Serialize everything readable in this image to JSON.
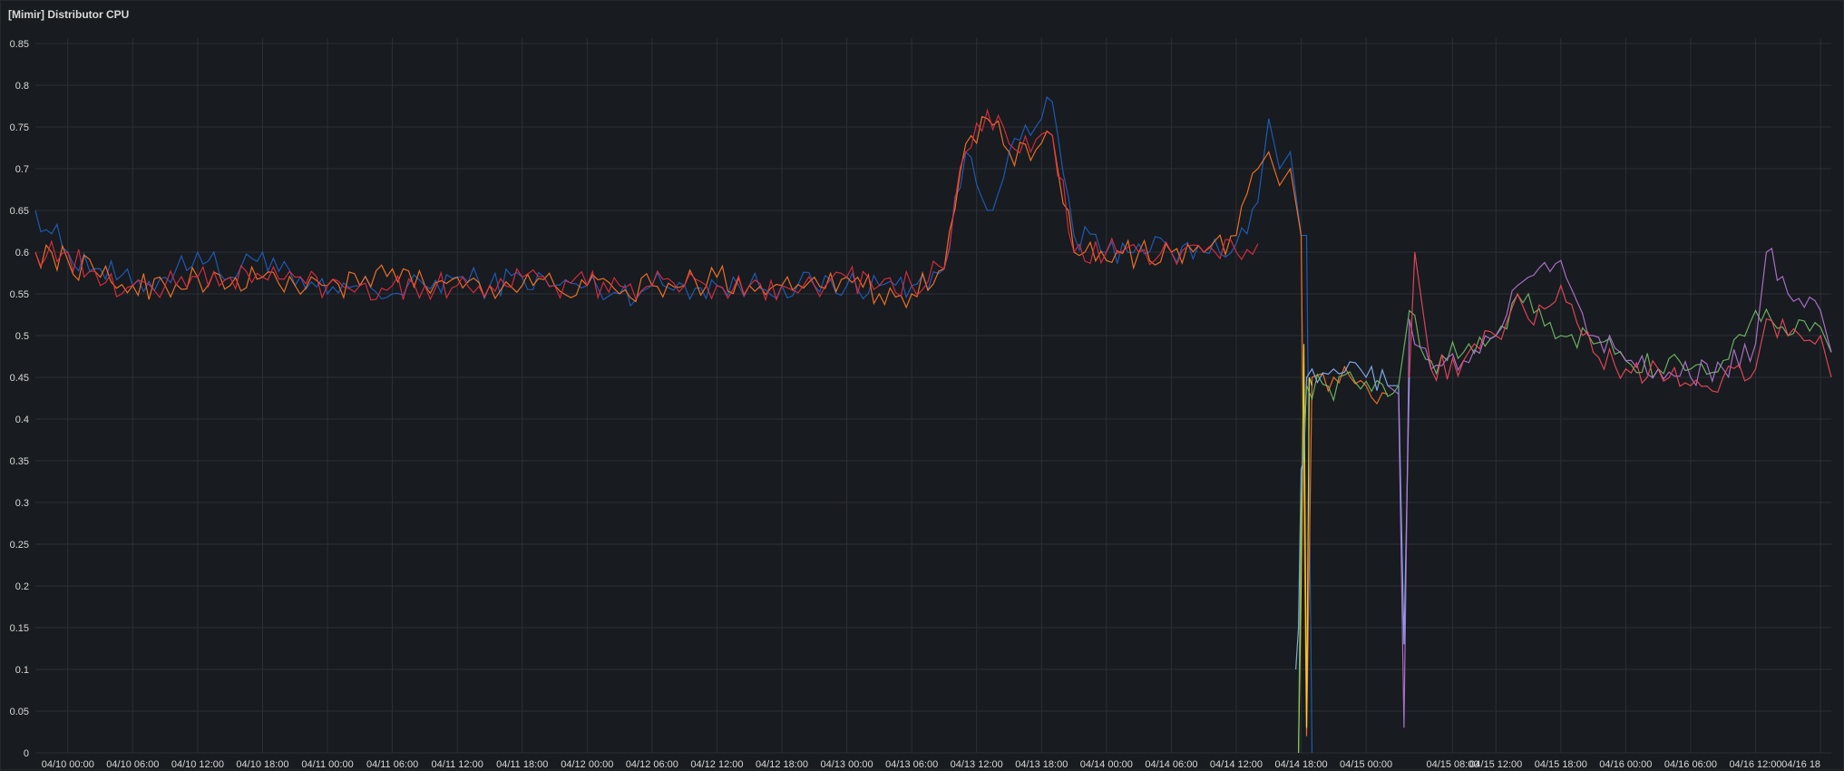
{
  "panel": {
    "title": "[Mimir] Distributor CPU"
  },
  "chart_data": {
    "type": "line",
    "title": "[Mimir] Distributor CPU",
    "xlabel": "",
    "ylabel": "",
    "ylim": [
      0,
      0.85
    ],
    "xlim": [
      "04/09 21:00",
      "04/16 19:00"
    ],
    "grid": true,
    "legend": "none",
    "yticks": [
      0,
      0.05,
      0.1,
      0.15,
      0.2,
      0.25,
      0.3,
      0.35,
      0.4,
      0.45,
      0.5,
      0.55,
      0.6,
      0.65,
      0.7,
      0.75,
      0.8,
      0.85
    ],
    "ytick_labels": [
      "0",
      "0.05",
      "0.1",
      "0.15",
      "0.2",
      "0.25",
      "0.3",
      "0.35",
      "0.4",
      "0.45",
      "0.5",
      "0.55",
      "0.6",
      "0.65",
      "0.7",
      "0.75",
      "0.8",
      "0.85"
    ],
    "xticks": [
      "04/10 00:00",
      "04/10 06:00",
      "04/10 12:00",
      "04/10 18:00",
      "04/11 00:00",
      "04/11 06:00",
      "04/11 12:00",
      "04/11 18:00",
      "04/12 00:00",
      "04/12 06:00",
      "04/12 12:00",
      "04/12 18:00",
      "04/13 00:00",
      "04/13 06:00",
      "04/13 12:00",
      "04/13 18:00",
      "04/14 00:00",
      "04/14 06:00",
      "04/14 12:00",
      "04/14 18:00",
      "04/15 00:00",
      "04/15 08:00",
      "04/15 12:00",
      "04/15 18:00",
      "04/16 00:00",
      "04/16 06:00",
      "04/16 12:00",
      "04/16 18"
    ],
    "series": [
      {
        "color": "#1f60c4",
        "x": [
          "04/09 21:00",
          "04/10 00:00",
          "04/10 03:00",
          "04/10 06:00",
          "04/10 09:00",
          "04/10 12:00",
          "04/10 15:00",
          "04/10 18:00",
          "04/10 21:00",
          "04/11 00:00",
          "04/11 03:00",
          "04/11 06:00",
          "04/11 09:00",
          "04/11 12:00",
          "04/11 15:00",
          "04/11 18:00",
          "04/11 21:00",
          "04/12 00:00",
          "04/12 03:00",
          "04/12 06:00",
          "04/12 09:00",
          "04/12 12:00",
          "04/12 15:00",
          "04/12 18:00",
          "04/12 21:00",
          "04/13 00:00",
          "04/13 03:00",
          "04/13 06:00",
          "04/13 09:00",
          "04/13 11:00",
          "04/13 13:00",
          "04/13 15:00",
          "04/13 17:00",
          "04/13 19:00",
          "04/13 21:00",
          "04/14 00:00",
          "04/14 03:00",
          "04/14 06:00",
          "04/14 09:00",
          "04/14 12:00",
          "04/14 14:00",
          "04/14 15:00",
          "04/14 16:00",
          "04/14 17:00",
          "04/14 18:00",
          "04/14 18:30",
          "04/14 19:00",
          "04/14 21:00",
          "04/15 00:00",
          "04/15 02:00",
          "04/15 03:00"
        ],
        "values": [
          0.65,
          0.6,
          0.58,
          0.56,
          0.57,
          0.6,
          0.57,
          0.6,
          0.56,
          0.55,
          0.56,
          0.55,
          0.56,
          0.57,
          0.56,
          0.57,
          0.56,
          0.56,
          0.55,
          0.56,
          0.56,
          0.56,
          0.56,
          0.56,
          0.56,
          0.56,
          0.56,
          0.56,
          0.58,
          0.72,
          0.65,
          0.72,
          0.74,
          0.78,
          0.62,
          0.6,
          0.61,
          0.6,
          0.6,
          0.61,
          0.66,
          0.76,
          0.7,
          0.72,
          0.62,
          0.62,
          0.0,
          null,
          null,
          null,
          null
        ]
      },
      {
        "color": "#ff7828",
        "x": [
          "04/09 21:00",
          "04/10 00:00",
          "04/10 03:00",
          "04/10 06:00",
          "04/10 09:00",
          "04/10 12:00",
          "04/10 15:00",
          "04/10 18:00",
          "04/10 21:00",
          "04/11 00:00",
          "04/11 03:00",
          "04/11 06:00",
          "04/11 09:00",
          "04/11 12:00",
          "04/11 15:00",
          "04/11 18:00",
          "04/11 21:00",
          "04/12 00:00",
          "04/12 03:00",
          "04/12 06:00",
          "04/12 09:00",
          "04/12 12:00",
          "04/12 15:00",
          "04/12 18:00",
          "04/12 21:00",
          "04/13 00:00",
          "04/13 03:00",
          "04/13 06:00",
          "04/13 09:00",
          "04/13 11:00",
          "04/13 13:00",
          "04/13 15:00",
          "04/13 17:00",
          "04/13 19:00",
          "04/13 21:00",
          "04/14 00:00",
          "04/14 03:00",
          "04/14 06:00",
          "04/14 09:00",
          "04/14 12:00",
          "04/14 14:00",
          "04/14 15:00",
          "04/14 16:00",
          "04/14 17:00",
          "04/14 18:00",
          "04/14 18:30",
          "04/14 19:00",
          "04/14 21:00",
          "04/15 00:00",
          "04/15 02:00",
          "04/15 03:00"
        ],
        "values": [
          0.6,
          0.59,
          0.57,
          0.56,
          0.56,
          0.57,
          0.56,
          0.57,
          0.56,
          0.56,
          0.56,
          0.58,
          0.56,
          0.57,
          0.56,
          0.56,
          0.56,
          0.56,
          0.55,
          0.56,
          0.56,
          0.57,
          0.56,
          0.56,
          0.57,
          0.57,
          0.55,
          0.55,
          0.58,
          0.73,
          0.76,
          0.72,
          0.71,
          0.74,
          0.6,
          0.59,
          0.6,
          0.6,
          0.6,
          0.62,
          0.7,
          0.72,
          0.68,
          0.7,
          0.62,
          0.02,
          0.45,
          0.45,
          0.44,
          0.43,
          null
        ]
      },
      {
        "color": "#e02f44",
        "x": [
          "04/09 21:00",
          "04/10 00:00",
          "04/10 03:00",
          "04/10 06:00",
          "04/10 09:00",
          "04/10 12:00",
          "04/10 15:00",
          "04/10 18:00",
          "04/10 21:00",
          "04/11 00:00",
          "04/11 03:00",
          "04/11 06:00",
          "04/11 09:00",
          "04/11 12:00",
          "04/11 15:00",
          "04/11 18:00",
          "04/11 21:00",
          "04/12 00:00",
          "04/12 03:00",
          "04/12 06:00",
          "04/12 09:00",
          "04/12 12:00",
          "04/12 15:00",
          "04/12 18:00",
          "04/12 21:00",
          "04/13 00:00",
          "04/13 03:00",
          "04/13 06:00",
          "04/13 09:00",
          "04/13 11:00",
          "04/13 13:00",
          "04/13 15:00",
          "04/13 17:00",
          "04/13 19:00",
          "04/13 21:00",
          "04/14 00:00",
          "04/14 03:00",
          "04/14 06:00",
          "04/14 09:00",
          "04/14 12:00",
          "04/14 14:00"
        ],
        "values": [
          0.6,
          0.6,
          0.56,
          0.56,
          0.56,
          0.57,
          0.57,
          0.57,
          0.57,
          0.56,
          0.56,
          0.56,
          0.56,
          0.56,
          0.56,
          0.57,
          0.56,
          0.56,
          0.56,
          0.56,
          0.56,
          0.56,
          0.56,
          0.56,
          0.56,
          0.57,
          0.56,
          0.56,
          0.58,
          0.72,
          0.77,
          0.73,
          0.72,
          0.74,
          0.6,
          0.6,
          0.6,
          0.6,
          0.6,
          0.6,
          0.61
        ]
      },
      {
        "color": "#fade2a",
        "x": [
          "04/14 17:45",
          "04/14 18:00",
          "04/14 18:15",
          "04/14 18:30",
          "04/14 18:45",
          "04/14 19:00"
        ],
        "values": [
          0.0,
          0.2,
          0.49,
          0.03,
          0.45,
          0.44
        ]
      },
      {
        "color": "#8ab8ff",
        "x": [
          "04/14 17:30",
          "04/14 17:45",
          "04/14 18:00",
          "04/14 18:15",
          "04/14 18:30",
          "04/14 19:00",
          "04/14 21:00",
          "04/15 00:00",
          "04/15 02:00",
          "04/15 03:00",
          "04/15 03:30",
          "04/15 04:00"
        ],
        "values": [
          0.1,
          0.15,
          0.34,
          0.35,
          0.45,
          0.46,
          0.46,
          0.45,
          0.44,
          0.44,
          0.13,
          0.45
        ]
      },
      {
        "color": "#73bf69",
        "x": [
          "04/14 17:45",
          "04/14 18:00",
          "04/14 18:30",
          "04/15 03:00",
          "04/15 04:00",
          "04/15 06:00",
          "04/15 09:00",
          "04/15 12:00",
          "04/15 15:00",
          "04/15 18:00",
          "04/15 21:00",
          "04/16 00:00",
          "04/16 03:00",
          "04/16 06:00",
          "04/16 09:00",
          "04/16 12:00",
          "04/16 15:00",
          "04/16 18:00",
          "04/16 19:00"
        ],
        "values": [
          0.0,
          0.3,
          0.44,
          0.44,
          0.53,
          0.47,
          0.48,
          0.5,
          0.55,
          0.5,
          0.49,
          0.47,
          0.46,
          0.46,
          0.47,
          0.53,
          0.5,
          0.51,
          0.48
        ]
      },
      {
        "color": "#b877d9",
        "x": [
          "04/15 02:00",
          "04/15 03:00",
          "04/15 03:30",
          "04/15 04:00",
          "04/15 06:00",
          "04/15 09:00",
          "04/15 12:00",
          "04/15 14:00",
          "04/15 15:00",
          "04/15 18:00",
          "04/15 21:00",
          "04/16 00:00",
          "04/16 03:00",
          "04/16 06:00",
          "04/16 09:00",
          "04/16 12:00",
          "04/16 13:00",
          "04/16 15:00",
          "04/16 18:00",
          "04/16 19:00"
        ],
        "values": [
          0.44,
          0.43,
          0.03,
          0.52,
          0.46,
          0.47,
          0.5,
          0.56,
          0.57,
          0.59,
          0.5,
          0.47,
          0.46,
          0.45,
          0.46,
          0.49,
          0.6,
          0.55,
          0.53,
          0.48
        ]
      },
      {
        "color": "#f2495c",
        "x": [
          "04/15 04:00",
          "04/15 04:30",
          "04/15 06:00",
          "04/15 09:00",
          "04/15 12:00",
          "04/15 14:00",
          "04/15 15:00",
          "04/15 18:00",
          "04/15 21:00",
          "04/16 00:00",
          "04/16 03:00",
          "04/16 06:00",
          "04/16 09:00",
          "04/16 12:00",
          "04/16 13:00",
          "04/16 15:00",
          "04/16 18:00",
          "04/16 19:00"
        ],
        "values": [
          0.45,
          0.6,
          0.46,
          0.47,
          0.5,
          0.55,
          0.52,
          0.56,
          0.48,
          0.46,
          0.46,
          0.44,
          0.45,
          0.46,
          0.52,
          0.5,
          0.5,
          0.45
        ]
      }
    ]
  }
}
